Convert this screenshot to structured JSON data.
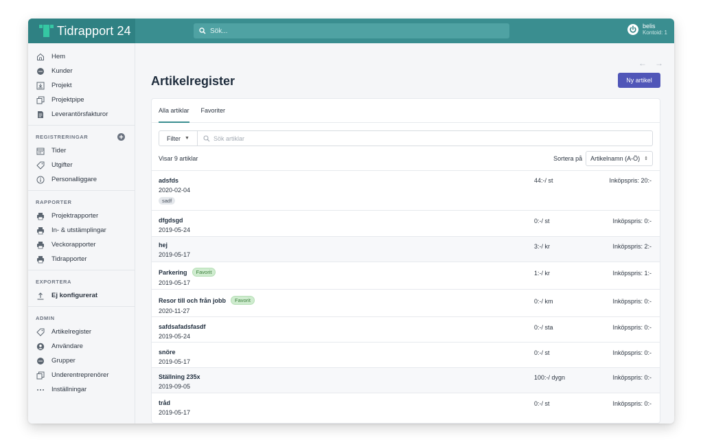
{
  "app": {
    "brand": "Tidrapport 24",
    "search_placeholder": "Sök...",
    "user_name": "belis",
    "user_account": "Kontoid: 1"
  },
  "sidebar": {
    "main_items": [
      {
        "label": "Hem",
        "icon": "home-icon"
      },
      {
        "label": "Kunder",
        "icon": "chat-icon"
      },
      {
        "label": "Projekt",
        "icon": "inbox-icon"
      },
      {
        "label": "Projektpipe",
        "icon": "copy-icon"
      },
      {
        "label": "Leverantörsfakturor",
        "icon": "document-icon"
      }
    ],
    "registreringar": {
      "title": "REGISTRERINGAR",
      "items": [
        {
          "label": "Tider",
          "icon": "calendar-icon"
        },
        {
          "label": "Utgifter",
          "icon": "tag-icon"
        },
        {
          "label": "Personalliggare",
          "icon": "info-icon"
        }
      ]
    },
    "rapporter": {
      "title": "RAPPORTER",
      "items": [
        {
          "label": "Projektrapporter",
          "icon": "printer-icon"
        },
        {
          "label": "In- & utstämplingar",
          "icon": "printer-icon"
        },
        {
          "label": "Veckorapporter",
          "icon": "printer-icon"
        },
        {
          "label": "Tidrapporter",
          "icon": "printer-icon"
        }
      ]
    },
    "exportera": {
      "title": "EXPORTERA",
      "items": [
        {
          "label": "Ej konfigurerat",
          "icon": "upload-icon"
        }
      ]
    },
    "admin": {
      "title": "ADMIN",
      "items": [
        {
          "label": "Artikelregister",
          "icon": "tag-icon"
        },
        {
          "label": "Användare",
          "icon": "user-circle-icon"
        },
        {
          "label": "Grupper",
          "icon": "chat-icon"
        },
        {
          "label": "Underentreprenörer",
          "icon": "copy-icon"
        },
        {
          "label": "Inställningar",
          "icon": "more-icon"
        }
      ]
    }
  },
  "main": {
    "title": "Artikelregister",
    "new_button": "Ny artikel",
    "nav_back": "←",
    "nav_forward": "→",
    "tabs": [
      "Alla artiklar",
      "Favoriter"
    ],
    "filter_label": "Filter",
    "search_placeholder": "Sök artiklar",
    "count_text": "Visar 9 artiklar",
    "sort_label": "Sortera på",
    "sort_value": "Artikelnamn (A-Ö)",
    "favorite_label": "Favorit",
    "articles": [
      {
        "name": "adsfds",
        "date": "2020-02-04",
        "price": "44:-/ st",
        "cost": "Inköpspris: 20:-",
        "tag": "sadf",
        "favorite": false
      },
      {
        "name": "dfgdsgd",
        "date": "2019-05-24",
        "price": "0:-/ st",
        "cost": "Inköpspris: 0:-",
        "tag": "",
        "favorite": false
      },
      {
        "name": "hej",
        "date": "2019-05-17",
        "price": "3:-/ kr",
        "cost": "Inköpspris: 2:-",
        "tag": "",
        "favorite": false
      },
      {
        "name": "Parkering",
        "date": "2019-05-17",
        "price": "1:-/ kr",
        "cost": "Inköpspris: 1:-",
        "tag": "",
        "favorite": true
      },
      {
        "name": "Resor till och från jobb",
        "date": "2020-11-27",
        "price": "0:-/ km",
        "cost": "Inköpspris: 0:-",
        "tag": "",
        "favorite": true
      },
      {
        "name": "safdsafadsfasdf",
        "date": "2019-05-24",
        "price": "0:-/ sta",
        "cost": "Inköpspris: 0:-",
        "tag": "",
        "favorite": false
      },
      {
        "name": "snöre",
        "date": "2019-05-17",
        "price": "0:-/ st",
        "cost": "Inköpspris: 0:-",
        "tag": "",
        "favorite": false
      },
      {
        "name": "Ställning 235x",
        "date": "2019-09-05",
        "price": "100:-/ dygn",
        "cost": "Inköpspris: 0:-",
        "tag": "",
        "favorite": false
      },
      {
        "name": "tråd",
        "date": "2019-05-17",
        "price": "0:-/ st",
        "cost": "Inköpspris: 0:-",
        "tag": "",
        "favorite": false
      }
    ]
  },
  "colors": {
    "topbar": "#3a8e90",
    "brand_bg": "#2f8183",
    "accent_button": "#5056b8",
    "favorite_badge": "#cfeccf"
  }
}
